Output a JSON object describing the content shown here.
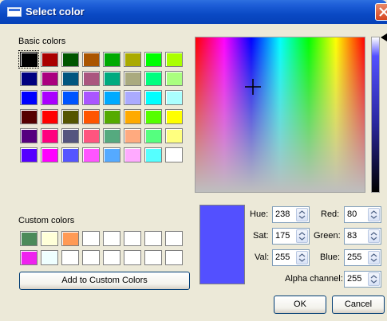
{
  "window": {
    "title": "Select color"
  },
  "basic_colors": {
    "label": "Basic colors",
    "rows": [
      [
        "#000000",
        "#aa0000",
        "#005500",
        "#aa5500",
        "#00aa00",
        "#aaaa00",
        "#00ff00",
        "#aaff00"
      ],
      [
        "#00007f",
        "#aa007f",
        "#00557f",
        "#aa557f",
        "#00aa7f",
        "#aaaa7f",
        "#00ff7f",
        "#aaff7f"
      ],
      [
        "#0000ff",
        "#aa00ff",
        "#0055ff",
        "#aa55ff",
        "#00aaff",
        "#aaaaff",
        "#00ffff",
        "#aaffff"
      ],
      [
        "#550000",
        "#ff0000",
        "#555500",
        "#ff5500",
        "#55aa00",
        "#ffaa00",
        "#55ff00",
        "#ffff00"
      ],
      [
        "#55007f",
        "#ff007f",
        "#55557f",
        "#ff557f",
        "#55aa7f",
        "#ffaa7f",
        "#55ff7f",
        "#ffff7f"
      ],
      [
        "#5500ff",
        "#ff00ff",
        "#5555ff",
        "#ff55ff",
        "#55aaff",
        "#ffaaff",
        "#55ffff",
        "#ffffff"
      ]
    ],
    "selected": "#000000"
  },
  "custom_colors": {
    "label": "Custom colors",
    "rows": [
      [
        "#4b8a5a",
        "#ffffd8",
        "#ff9a55",
        "#ffffff",
        "#ffffff",
        "#ffffff",
        "#ffffff",
        "#ffffff"
      ],
      [
        "#ee22ee",
        "#efffff",
        "#ffffff",
        "#ffffff",
        "#ffffff",
        "#ffffff",
        "#ffffff",
        "#ffffff"
      ]
    ],
    "add_button": "Add to Custom Colors"
  },
  "current_color": "#5350ff",
  "fields": {
    "hue": {
      "label": "Hue:",
      "value": "238"
    },
    "sat": {
      "label": "Sat:",
      "value": "175"
    },
    "val": {
      "label": "Val:",
      "value": "255"
    },
    "red": {
      "label": "Red:",
      "value": "80"
    },
    "green": {
      "label": "Green:",
      "value": "83"
    },
    "blue": {
      "label": "Blue:",
      "value": "255"
    },
    "alpha": {
      "label": "Alpha channel:",
      "value": "255"
    }
  },
  "buttons": {
    "ok": "OK",
    "cancel": "Cancel"
  },
  "icons": {
    "window": "window-icon",
    "close": "close-icon",
    "crosshair": "crosshair-icon",
    "luminance_pointer": "triangle-pointer-icon",
    "spin": "spin-arrows-icon"
  }
}
